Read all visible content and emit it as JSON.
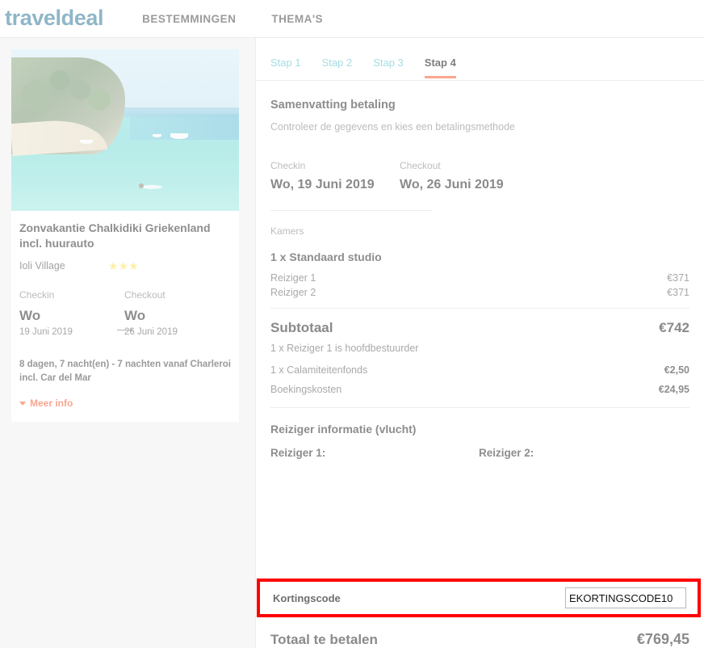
{
  "header": {
    "logo": "traveldeal",
    "nav": [
      {
        "label": "BESTEMMINGEN"
      },
      {
        "label": "THEMA'S"
      }
    ]
  },
  "sidebar": {
    "photo_alt": "beach-photo",
    "trip_title": "Zonvakantie Chalkidiki Griekenland incl. huurauto",
    "hotel_name": "Ioli Village",
    "stars": "★★★",
    "checkin_label": "Checkin",
    "checkout_label": "Checkout",
    "checkin_day": "Wo",
    "checkin_date": "19 Juni 2019",
    "checkout_day": "Wo",
    "checkout_date": "26 Juni 2019",
    "arrow": "⟶",
    "description": "8 dagen, 7 nacht(en)  - 7 nachten vanaf Charleroi incl. Car del Mar",
    "more_info": "Meer info"
  },
  "main": {
    "tabs": [
      {
        "label": "Stap 1",
        "active": false
      },
      {
        "label": "Stap 2",
        "active": false
      },
      {
        "label": "Stap 3",
        "active": false
      },
      {
        "label": "Stap 4",
        "active": true
      }
    ],
    "section_title": "Samenvatting betaling",
    "section_subtitle": "Controleer de gegevens en kies een betalingsmethode",
    "checkin_label": "Checkin",
    "checkout_label": "Checkout",
    "checkin_value": "Wo, 19 Juni 2019",
    "checkout_value": "Wo, 26 Juni 2019",
    "rooms_label": "Kamers",
    "room_title": "1 x Standaard studio",
    "room_lines": [
      {
        "label": "Reiziger 1",
        "amount": "€371"
      },
      {
        "label": "Reiziger 2",
        "amount": "€371"
      }
    ],
    "subtotal_label": "Subtotaal",
    "subtotal_amount": "€742",
    "subtotal_note": "1 x Reiziger 1 is hoofdbestuurder",
    "fees": [
      {
        "label": "1 x Calamiteitenfonds",
        "amount": "€2,50"
      },
      {
        "label": "Boekingskosten",
        "amount": "€24,95"
      }
    ],
    "traveler_section_title": "Reiziger informatie (vlucht)",
    "travelers": [
      {
        "label": "Reiziger 1:"
      },
      {
        "label": "Reiziger 2:"
      }
    ],
    "discount_label": "Kortingscode",
    "discount_value": "EKORTINGSCODE10",
    "discount_placeholder": "Kortingscode",
    "total_label": "Totaal te betalen",
    "total_amount": "€769,45"
  },
  "colors": {
    "logo": "#8fb6c8",
    "accent": "#faa68f",
    "tab_inactive": "#a6dde2",
    "highlight_border": "#fe0000",
    "star": "#fdf0a8",
    "page_bg": "#f7f7f7"
  }
}
